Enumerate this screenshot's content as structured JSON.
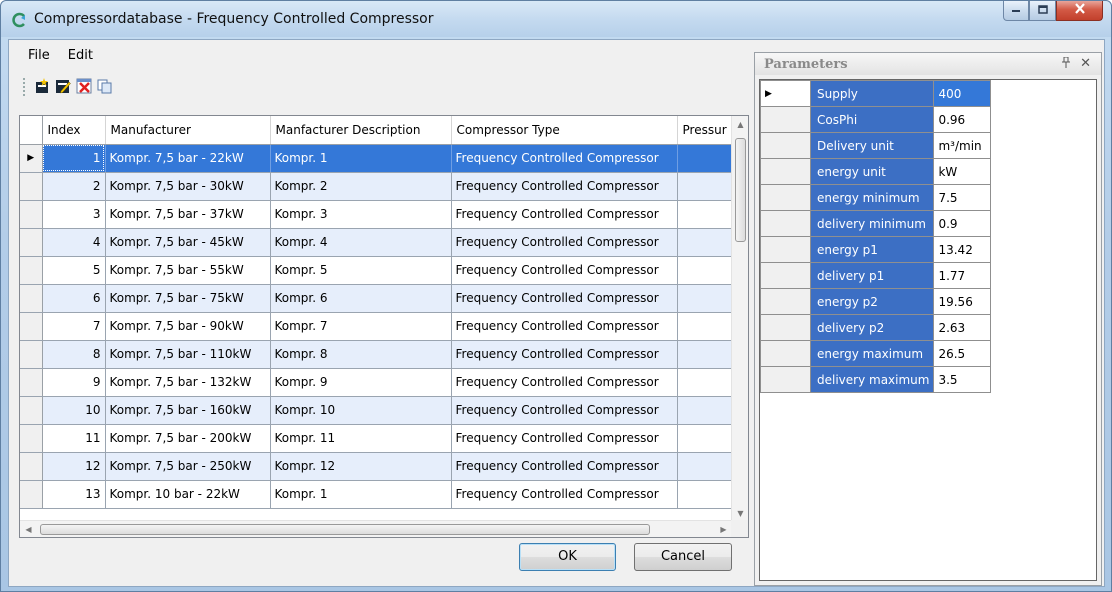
{
  "window": {
    "title": "Compressordatabase - Frequency Controlled Compressor",
    "icon": "app-logo-icon",
    "controls": {
      "minimize": "minimize-icon",
      "maximize": "maximize-icon",
      "close": "close-icon"
    }
  },
  "menu": {
    "file": "File",
    "edit": "Edit"
  },
  "toolbar": {
    "buttons": [
      {
        "icon": "new-record-icon"
      },
      {
        "icon": "edit-record-icon"
      },
      {
        "icon": "delete-record-icon"
      },
      {
        "icon": "copy-record-icon"
      }
    ]
  },
  "grid": {
    "columns": [
      "Index",
      "Manufacturer",
      "Manfacturer Description",
      "Compressor Type",
      "Pressur"
    ],
    "rows": [
      {
        "index": "1",
        "manufacturer": "Kompr. 7,5 bar - 22kW",
        "description": "Kompr. 1",
        "type": "Frequency Controlled Compressor"
      },
      {
        "index": "2",
        "manufacturer": "Kompr. 7,5 bar - 30kW",
        "description": "Kompr. 2",
        "type": "Frequency Controlled Compressor"
      },
      {
        "index": "3",
        "manufacturer": "Kompr. 7,5 bar - 37kW",
        "description": "Kompr. 3",
        "type": "Frequency Controlled Compressor"
      },
      {
        "index": "4",
        "manufacturer": "Kompr. 7,5 bar - 45kW",
        "description": "Kompr. 4",
        "type": "Frequency Controlled Compressor"
      },
      {
        "index": "5",
        "manufacturer": "Kompr. 7,5 bar - 55kW",
        "description": "Kompr. 5",
        "type": "Frequency Controlled Compressor"
      },
      {
        "index": "6",
        "manufacturer": "Kompr. 7,5 bar - 75kW",
        "description": "Kompr. 6",
        "type": "Frequency Controlled Compressor"
      },
      {
        "index": "7",
        "manufacturer": "Kompr. 7,5 bar - 90kW",
        "description": "Kompr. 7",
        "type": "Frequency Controlled Compressor"
      },
      {
        "index": "8",
        "manufacturer": "Kompr. 7,5 bar - 110kW",
        "description": "Kompr. 8",
        "type": "Frequency Controlled Compressor"
      },
      {
        "index": "9",
        "manufacturer": "Kompr. 7,5 bar - 132kW",
        "description": "Kompr. 9",
        "type": "Frequency Controlled Compressor"
      },
      {
        "index": "10",
        "manufacturer": "Kompr. 7,5 bar - 160kW",
        "description": "Kompr. 10",
        "type": "Frequency Controlled Compressor"
      },
      {
        "index": "11",
        "manufacturer": "Kompr. 7,5 bar - 200kW",
        "description": "Kompr. 11",
        "type": "Frequency Controlled Compressor"
      },
      {
        "index": "12",
        "manufacturer": "Kompr. 7,5 bar - 250kW",
        "description": "Kompr. 12",
        "type": "Frequency Controlled Compressor"
      },
      {
        "index": "13",
        "manufacturer": "Kompr. 10 bar - 22kW",
        "description": "Kompr. 1",
        "type": "Frequency Controlled Compressor"
      }
    ]
  },
  "buttons": {
    "ok": "OK",
    "cancel": "Cancel"
  },
  "parameters": {
    "title": "Parameters",
    "pin_icon": "pin-icon",
    "close_icon": "close-icon",
    "rows": [
      {
        "name": "Supply",
        "value": "400"
      },
      {
        "name": "CosPhi",
        "value": "0.96"
      },
      {
        "name": "Delivery unit",
        "value": "m³/min"
      },
      {
        "name": "energy unit",
        "value": "kW"
      },
      {
        "name": "energy minimum",
        "value": "7.5"
      },
      {
        "name": "delivery minimum",
        "value": "0.9"
      },
      {
        "name": "energy p1",
        "value": "13.42"
      },
      {
        "name": "delivery p1",
        "value": "1.77"
      },
      {
        "name": "energy p2",
        "value": "19.56"
      },
      {
        "name": "delivery p2",
        "value": "2.63"
      },
      {
        "name": "energy maximum",
        "value": "26.5"
      },
      {
        "name": "delivery maximum",
        "value": "3.5"
      }
    ]
  },
  "colors": {
    "selection": "#3478d8",
    "alt_row": "#e6eefb",
    "param_name_bg": "#3c6fc4"
  }
}
